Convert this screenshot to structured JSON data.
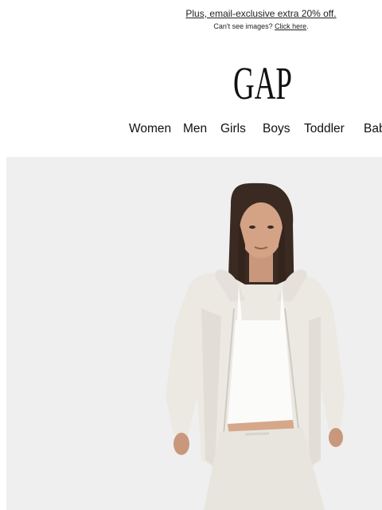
{
  "preheader": {
    "promo_text": "Plus, email-exclusive extra 20% off.",
    "cant_see_text": "Can't see images?",
    "click_here": "Click here",
    "period": "."
  },
  "brand": {
    "name": "GAP"
  },
  "nav": {
    "items": [
      "Women",
      "Men",
      "Girls",
      "Boys",
      "Toddler",
      "Bab"
    ]
  },
  "hero": {
    "description_visible": false
  },
  "colors": {
    "background": "#ffffff",
    "hero_background": "#efefef",
    "text": "#111111"
  }
}
